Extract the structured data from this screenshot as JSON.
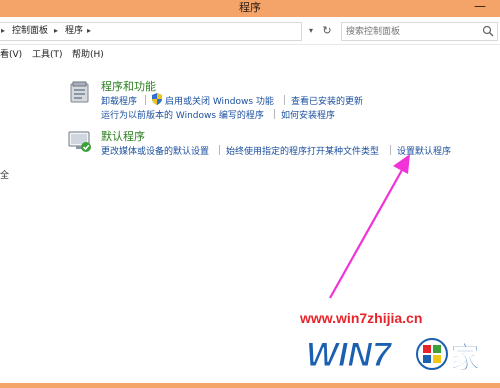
{
  "window": {
    "title": "程序",
    "minimize_glyph": "—"
  },
  "address": {
    "crumbs": [
      "控制面板",
      "程序"
    ],
    "search_placeholder": "搜索控制面板"
  },
  "menu": {
    "items": [
      "看(V)",
      "工具(T)",
      "帮助(H)"
    ]
  },
  "categories": [
    {
      "icon": "programs-and-features-icon",
      "title": "程序和功能",
      "rows": [
        [
          "卸载程序",
          "启用或关闭 Windows 功能",
          "查看已安装的更新"
        ],
        [
          "运行为以前版本的 Windows 编写的程序",
          "如何安装程序"
        ]
      ]
    },
    {
      "icon": "default-programs-icon",
      "title": "默认程序",
      "rows": [
        [
          "更改媒体或设备的默认设置",
          "始终使用指定的程序打开某种文件类型",
          "设置默认程序"
        ]
      ]
    }
  ],
  "side_text": "全",
  "watermark": {
    "url": "www.win7zhijia.cn",
    "logo_text": "WIN7",
    "logo_char": "家"
  },
  "colors": {
    "titlebar": "#f4a468",
    "link": "#1a4f9e",
    "category_title": "#2b7f1e",
    "arrow": "#f032d8",
    "watermark": "#e8242b",
    "logo_blue": "#1b5fb0"
  }
}
